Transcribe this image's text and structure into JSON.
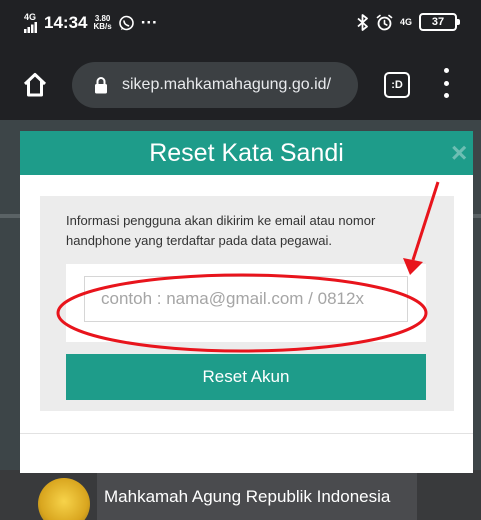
{
  "status_bar": {
    "network": "4G",
    "time": "14:34",
    "speed_value": "3.80",
    "speed_unit": "KB/s",
    "whatsapp_icon": "whatsapp-icon",
    "more": "···",
    "bluetooth_icon": "bluetooth-icon",
    "alarm_icon": "alarm-icon",
    "signal2": "4G",
    "battery": "37"
  },
  "browser": {
    "url": "sikep.mahkamahagung.go.id/",
    "tab_label": ":D",
    "home_icon": "home-icon",
    "lock_icon": "lock-icon",
    "menu_icon": "more-vert-icon"
  },
  "modal": {
    "title": "Reset Kata Sandi",
    "close_label": "×",
    "info_text": "Informasi pengguna akan dikirim ke email atau nomor handphone yang terdaftar pada data pegawai.",
    "input_placeholder": "contoh : nama@gmail.com / 0812x",
    "button_label": "Reset Akun"
  },
  "footer": {
    "org_name": "Mahkamah Agung Republik Indonesia"
  },
  "colors": {
    "accent": "#1e9c8a",
    "status_bar": "#202124",
    "annotation": "#e8141c"
  }
}
